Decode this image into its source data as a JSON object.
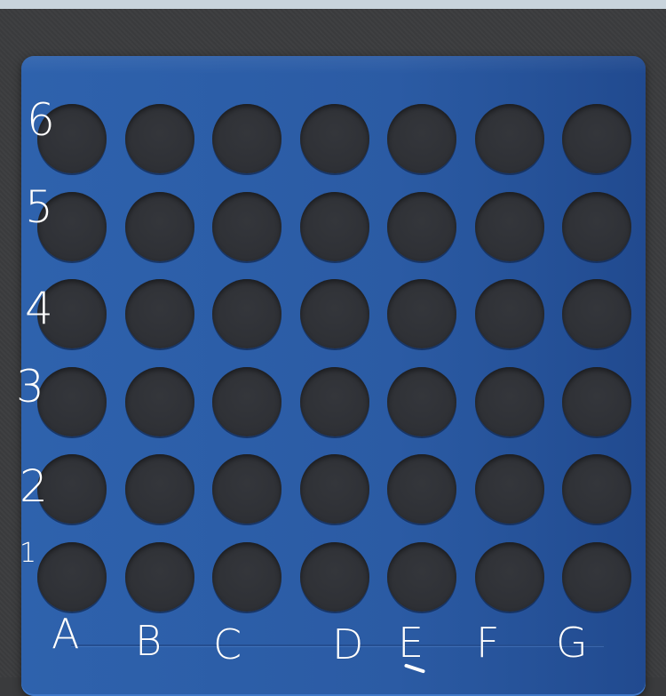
{
  "board": {
    "columns": 7,
    "rows": 6,
    "board_color": "#2b5ba4",
    "slot_color": "#303237",
    "background_color": "#3a3b3d",
    "cells_filled": 0
  },
  "row_labels": [
    "6",
    "5",
    "4",
    "3",
    "2",
    "1"
  ],
  "column_labels": [
    "A",
    "B",
    "C",
    "D",
    "E",
    "F",
    "G"
  ]
}
